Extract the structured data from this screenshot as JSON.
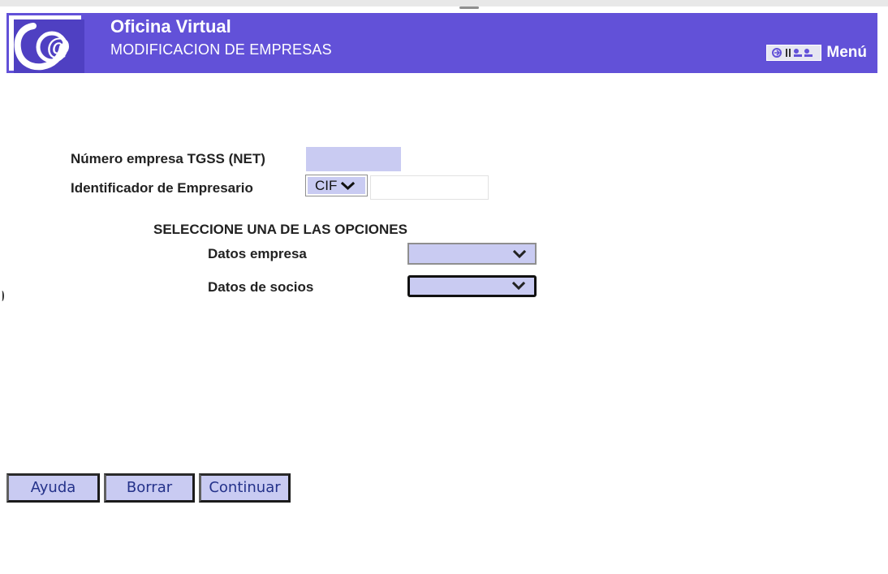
{
  "header": {
    "app_title": "Oficina Virtual",
    "page_subtitle": "MODIFICACION DE EMPRESAS",
    "menu_label": "Menú",
    "logo_icon": "at-sign-logo-icon",
    "menu_icon": "menu-grid-icon",
    "brand_color": "#6251d8"
  },
  "form": {
    "net_label": "Número empresa TGSS (NET)",
    "net_value": "",
    "employer_id_label": "Identificador de Empresario",
    "employer_id_type": "CIF",
    "employer_id_value": "",
    "section_title": "SELECCIONE UNA DE LAS OPCIONES",
    "company_data_label": "Datos empresa",
    "company_data_value": "",
    "partners_data_label": "Datos de socios",
    "partners_data_value": ""
  },
  "buttons": {
    "help": "Ayuda",
    "clear": "Borrar",
    "continue": "Continuar"
  }
}
